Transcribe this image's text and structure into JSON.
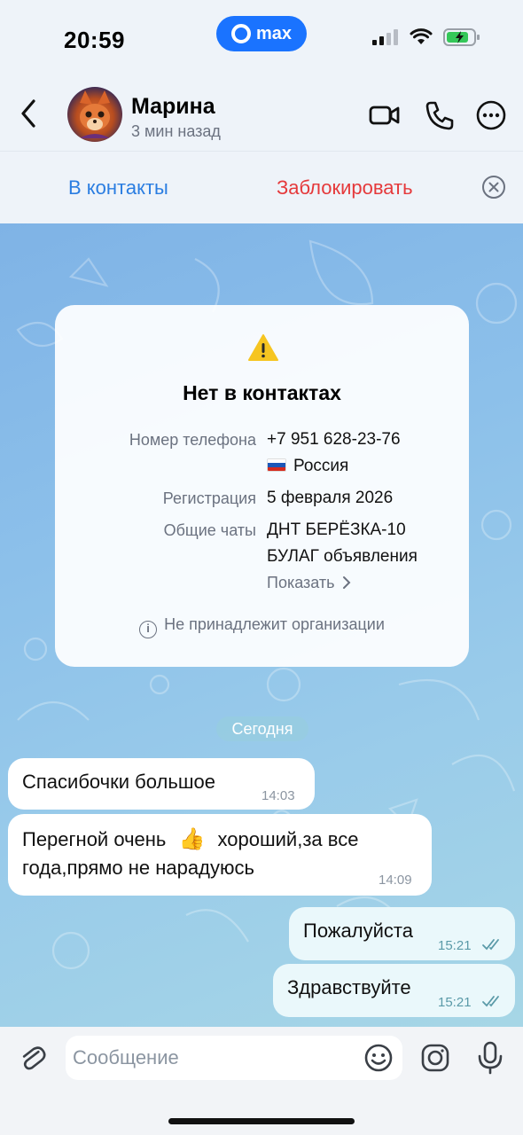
{
  "status_bar": {
    "time": "20:59",
    "app_pill": "max",
    "battery_color": "#34c759"
  },
  "header": {
    "name": "Марина",
    "status": "3 мин назад"
  },
  "actions": {
    "add_contact": "В контакты",
    "block": "Заблокировать"
  },
  "info_card": {
    "title": "Нет в контактах",
    "phone_label": "Номер телефона",
    "phone_value": "+7 951 628-23-76",
    "country": "Россия",
    "registration_label": "Регистрация",
    "registration_value": "5 февраля 2026",
    "common_chats_label": "Общие чаты",
    "common_chats": [
      "ДНТ БЕРЁЗКА-10",
      "БУЛАГ объявления"
    ],
    "show_link": "Показать",
    "org_note": "Не принадлежит организации"
  },
  "date_separator": "Сегодня",
  "messages": [
    {
      "direction": "in",
      "text": "Спасибочки  большое",
      "time": "14:03"
    },
    {
      "direction": "in",
      "text_line1_a": "Перегной  очень",
      "emoji": "👍",
      "text_line1_b": "хороший,за все",
      "text_line2": "года,прямо не нарадуюсь",
      "time": "14:09"
    },
    {
      "direction": "out",
      "text": "Пожалуйста",
      "time": "15:21",
      "read": true
    },
    {
      "direction": "out",
      "text": "Здравствуйте",
      "time": "15:21",
      "read": true
    }
  ],
  "composer": {
    "placeholder": "Сообщение",
    "value": ""
  },
  "colors": {
    "accent": "#2a7de1",
    "danger": "#e5393b",
    "max_brand": "#1a73ff"
  }
}
